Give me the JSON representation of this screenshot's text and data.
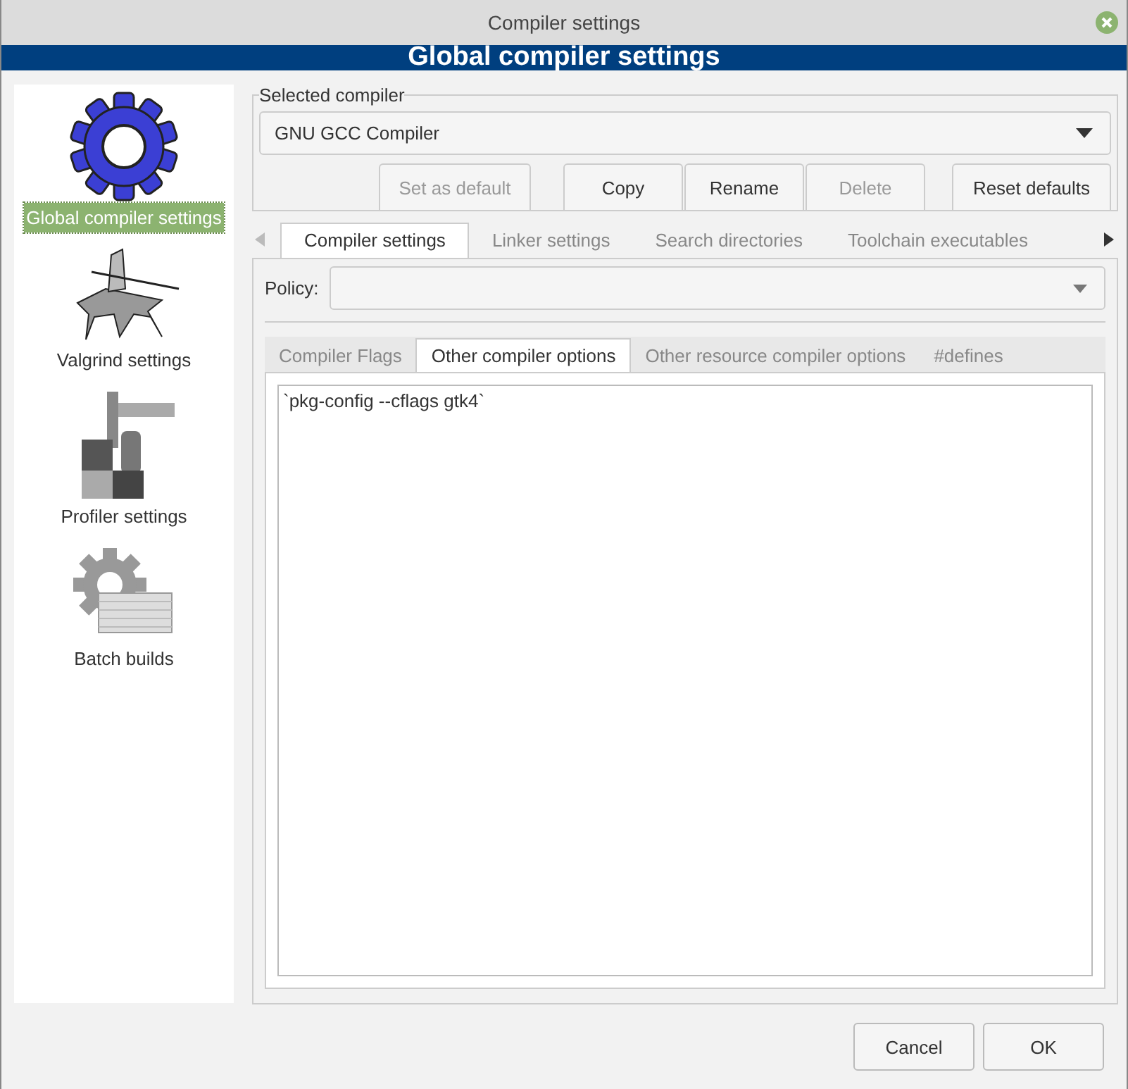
{
  "window": {
    "title": "Compiler settings"
  },
  "banner": "Global compiler settings",
  "sidebar": {
    "items": [
      {
        "label": "Global compiler settings",
        "kind": "gear",
        "selected": true
      },
      {
        "label": "Valgrind settings",
        "kind": "knight",
        "selected": false
      },
      {
        "label": "Profiler settings",
        "kind": "caliper",
        "selected": false
      },
      {
        "label": "Batch builds",
        "kind": "batch",
        "selected": false
      }
    ]
  },
  "selected_compiler": {
    "legend": "Selected compiler",
    "value": "GNU GCC Compiler"
  },
  "compiler_buttons": [
    {
      "label": "Set as default",
      "disabled": true
    },
    {
      "label": "Copy",
      "disabled": false
    },
    {
      "label": "Rename",
      "disabled": false
    },
    {
      "label": "Delete",
      "disabled": true
    },
    {
      "label": "Reset defaults",
      "disabled": false
    }
  ],
  "tabs": {
    "scroll_left_disabled": true,
    "scroll_right_disabled": false,
    "items": [
      {
        "label": "Compiler settings",
        "selected": true
      },
      {
        "label": "Linker settings",
        "selected": false
      },
      {
        "label": "Search directories",
        "selected": false
      },
      {
        "label": "Toolchain executables",
        "selected": false
      }
    ]
  },
  "policy": {
    "label": "Policy:"
  },
  "subtabs": [
    {
      "label": "Compiler Flags",
      "selected": false
    },
    {
      "label": "Other compiler options",
      "selected": true
    },
    {
      "label": "Other resource compiler options",
      "selected": false
    },
    {
      "label": "#defines",
      "selected": false
    }
  ],
  "options_text": "`pkg-config --cflags gtk4`",
  "buttons": [
    "Cancel",
    "OK"
  ]
}
